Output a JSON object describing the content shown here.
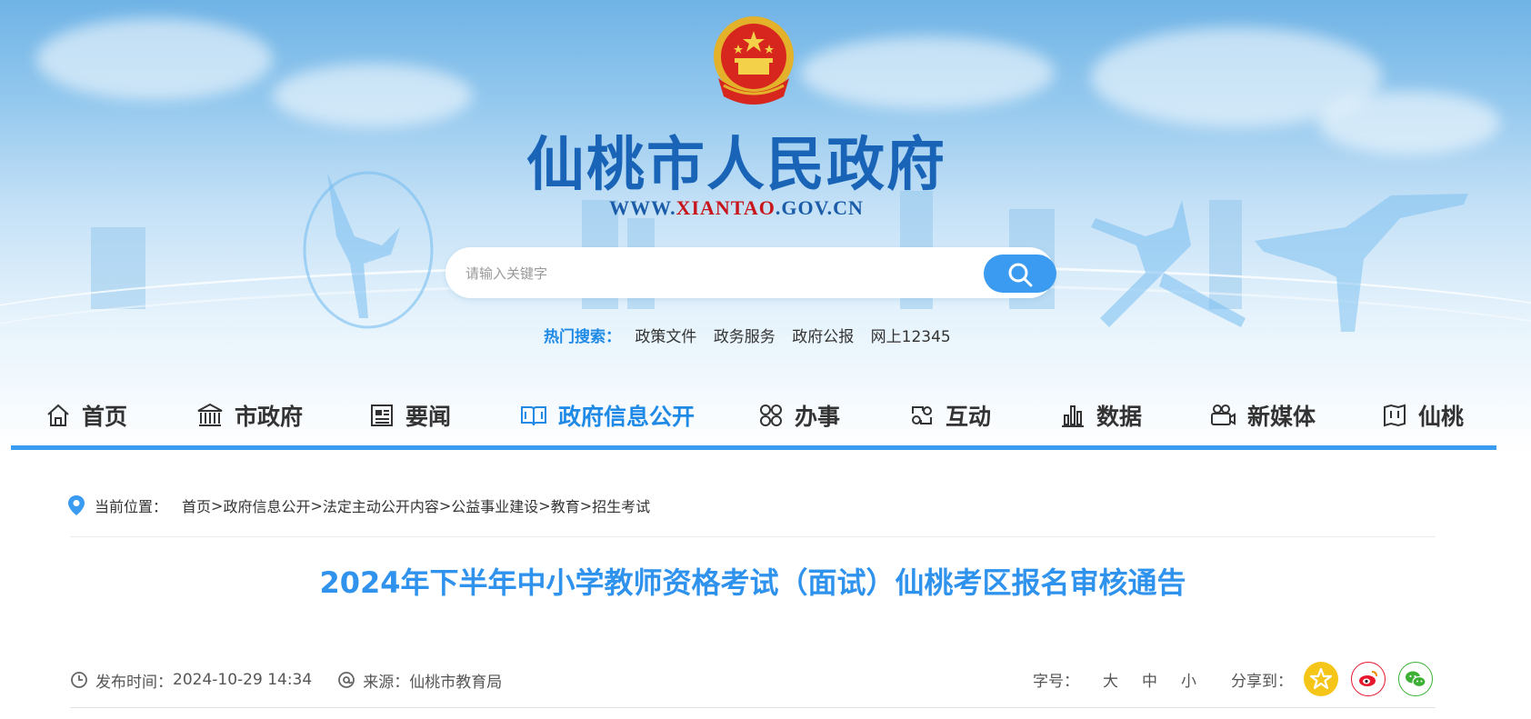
{
  "header": {
    "site_title": "仙桃市人民政府",
    "url_prefix": "WWW.",
    "url_brand": "XIANTAO",
    "url_suffix": ".GOV.CN"
  },
  "search": {
    "placeholder": "请输入关键字",
    "hot_label": "热门搜索：",
    "hot_items": [
      "政策文件",
      "政务服务",
      "政府公报",
      "网上12345"
    ]
  },
  "nav": {
    "items": [
      {
        "label": "首页",
        "icon": "home-icon"
      },
      {
        "label": "市政府",
        "icon": "government-building-icon"
      },
      {
        "label": "要闻",
        "icon": "news-icon"
      },
      {
        "label": "政府信息公开",
        "icon": "book-icon",
        "active": true
      },
      {
        "label": "办事",
        "icon": "grid-icon"
      },
      {
        "label": "互动",
        "icon": "interaction-icon"
      },
      {
        "label": "数据",
        "icon": "bar-chart-icon"
      },
      {
        "label": "新媒体",
        "icon": "camera-icon"
      },
      {
        "label": "仙桃",
        "icon": "map-icon"
      }
    ]
  },
  "breadcrumb": {
    "label": "当前位置：",
    "items": [
      "首页",
      "政府信息公开",
      "法定主动公开内容",
      "公益事业建设",
      "教育",
      "招生考试"
    ],
    "separator": ">"
  },
  "article": {
    "title": "2024年下半年中小学教师资格考试（面试）仙桃考区报名审核通告",
    "publish_label": "发布时间：",
    "publish_time": "2024-10-29 14:34",
    "source_label": "来源：",
    "source": "仙桃市教育局"
  },
  "tools": {
    "font_size_label": "字号：",
    "font_sizes": [
      "大",
      "中",
      "小"
    ],
    "share_label": "分享到：",
    "share_targets": [
      "favorite-icon",
      "weibo-icon",
      "wechat-icon"
    ]
  },
  "colors": {
    "accent": "#3a9bf0",
    "title_blue": "#1a64b7",
    "article_title": "#2f93ee",
    "url_red": "#c8161d",
    "star_yellow": "#f5c518",
    "weibo_red": "#e6162d",
    "wechat_green": "#3cb034"
  }
}
